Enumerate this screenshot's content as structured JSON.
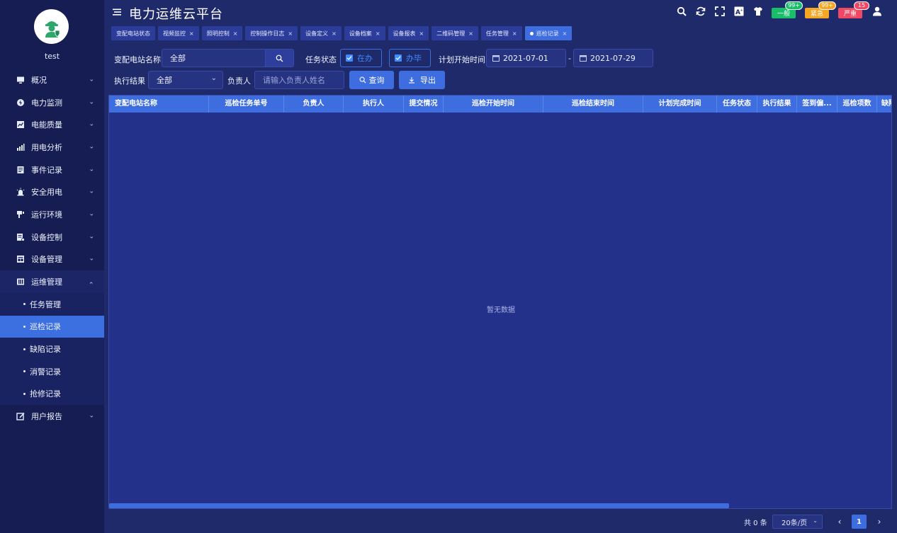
{
  "app": {
    "title": "电力运维云平台"
  },
  "user": {
    "name": "test"
  },
  "colors": {
    "accent": "#3e6de0",
    "sidebar": "#151d52",
    "background": "#1f2a6b",
    "alert_normal": "#19be6b",
    "alert_urgent": "#f5a623",
    "alert_severe": "#f04864"
  },
  "header": {
    "alerts": [
      {
        "label": "一般",
        "count": "99+",
        "color": "#19be6b"
      },
      {
        "label": "紧急",
        "count": "99+",
        "color": "#f5a623"
      },
      {
        "label": "严重",
        "count": "15",
        "color": "#f04864"
      }
    ]
  },
  "sidebar": {
    "items": [
      {
        "label": "概况",
        "icon": "monitor-icon"
      },
      {
        "label": "电力监测",
        "icon": "power-icon"
      },
      {
        "label": "电能质量",
        "icon": "quality-chart-icon"
      },
      {
        "label": "用电分析",
        "icon": "bar-chart-icon"
      },
      {
        "label": "事件记录",
        "icon": "event-icon"
      },
      {
        "label": "安全用电",
        "icon": "alarm-icon"
      },
      {
        "label": "运行环境",
        "icon": "environment-icon"
      },
      {
        "label": "设备控制",
        "icon": "device-control-icon"
      },
      {
        "label": "设备管理",
        "icon": "device-manage-icon"
      },
      {
        "label": "运维管理",
        "icon": "ops-icon"
      },
      {
        "label": "用户报告",
        "icon": "report-icon"
      }
    ],
    "submenu": [
      "任务管理",
      "巡检记录",
      "缺陷记录",
      "消警记录",
      "抢修记录"
    ]
  },
  "tabs": [
    {
      "label": "变配电站状态",
      "closable": false
    },
    {
      "label": "视频监控",
      "closable": true
    },
    {
      "label": "照明控制",
      "closable": true
    },
    {
      "label": "控制操作日志",
      "closable": true
    },
    {
      "label": "设备定义",
      "closable": true
    },
    {
      "label": "设备档案",
      "closable": true
    },
    {
      "label": "设备报表",
      "closable": true
    },
    {
      "label": "二维码管理",
      "closable": true
    },
    {
      "label": "任务管理",
      "closable": true
    },
    {
      "label": "巡检记录",
      "closable": true,
      "active": true
    }
  ],
  "filters": {
    "station_label": "变配电站名称",
    "station_value": "全部",
    "task_status_label": "任务状态",
    "status_in_progress": "在办",
    "status_done": "办毕",
    "plan_start_label": "计划开始时间",
    "date_start": "2021-07-01",
    "date_separator": "-",
    "date_end": "2021-07-29",
    "result_label": "执行结果",
    "result_value": "全部",
    "owner_label": "负责人",
    "owner_placeholder": "请输入负责人姓名",
    "query_button": "查询",
    "export_button": "导出"
  },
  "table": {
    "columns": [
      "变配电站名称",
      "巡检任务单号",
      "负责人",
      "执行人",
      "提交情况",
      "巡检开始时间",
      "巡检结束时间",
      "计划完成时间",
      "任务状态",
      "执行结果",
      "签到偏...",
      "巡检项数",
      "缺陷"
    ],
    "empty_text": "暂无数据"
  },
  "pagination": {
    "total_text": "共 0 条",
    "page_size": "20条/页",
    "current_page": "1",
    "prev": "‹",
    "next": "›"
  }
}
